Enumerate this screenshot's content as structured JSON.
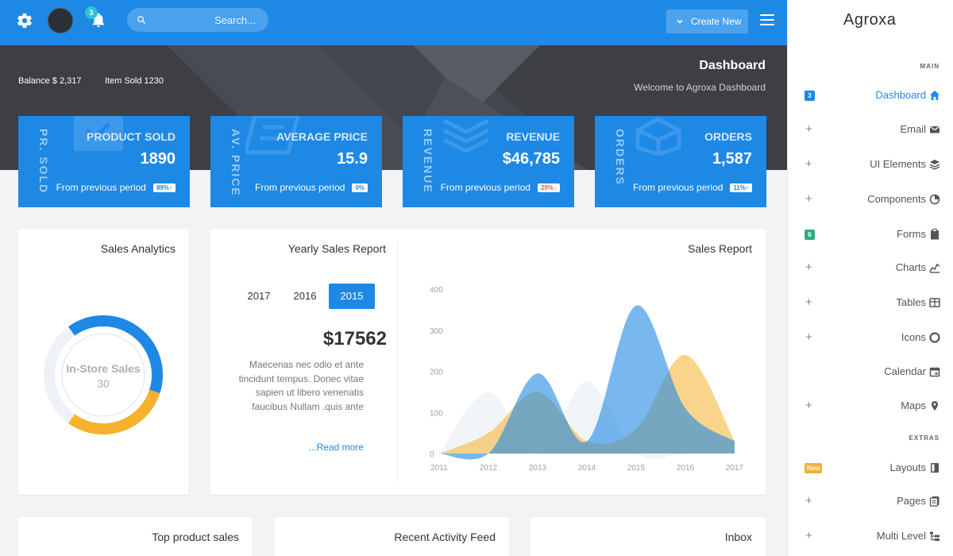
{
  "topbar": {
    "notification_count": "3",
    "search_placeholder": "...Search",
    "create_label": "Create New"
  },
  "header": {
    "balance": "Balance $ 2,317",
    "items_sold": "Item Sold 1230",
    "title": "Dashboard",
    "subtitle": "Welcome to Agroxa Dashboard"
  },
  "stats": [
    {
      "vertical": "PR. SOLD",
      "label": "PRODUCT SOLD",
      "value": "1890",
      "foot": "From previous period",
      "pill": "89%↑",
      "pill_color": "#1e88e5"
    },
    {
      "vertical": "AV. PRICE",
      "label": "AVERAGE PRICE",
      "value": "15.9",
      "foot": "From previous period",
      "pill": "0%",
      "pill_color": "#1e88e5"
    },
    {
      "vertical": "REVENUE",
      "label": "REVENUE",
      "value": "$46,785",
      "foot": "From previous period",
      "pill": "29%↓",
      "pill_color": "#ef5350"
    },
    {
      "vertical": "ORDERS",
      "label": "ORDERS",
      "value": "1,587",
      "foot": "From previous period",
      "pill": "11%↑",
      "pill_color": "#1e88e5"
    }
  ],
  "sales_analytics": {
    "title": "Sales Analytics",
    "center_label": "In-Store Sales",
    "center_value": "30",
    "segments": [
      {
        "value": 40,
        "color": "#1e88e5"
      },
      {
        "value": 30,
        "color": "#f7b12c"
      },
      {
        "value": 30,
        "color": "#eef1f5"
      }
    ]
  },
  "yearly_report": {
    "title": "Yearly Sales Report",
    "years": [
      "2017",
      "2016",
      "2015"
    ],
    "active_year": "2015",
    "amount": "$17562",
    "description": "Maecenas nec odio et ante tincidunt tempus. Donec vitae sapien ut libero venenatis faucibus Nullam .quis ante",
    "read_more": "...Read more"
  },
  "chart_data": {
    "type": "area",
    "title": "Sales Report",
    "x": [
      "2011",
      "2012",
      "2013",
      "2014",
      "2015",
      "2016",
      "2017"
    ],
    "ylim": [
      0,
      400
    ],
    "yticks": [
      "0",
      "100",
      "200",
      "300",
      "400"
    ],
    "series": [
      {
        "values": [
          0,
          150,
          0,
          175,
          0,
          0,
          0
        ],
        "color": "#eef1f5"
      },
      {
        "values": [
          0,
          50,
          150,
          30,
          60,
          240,
          30
        ],
        "color": "#f7b12c"
      },
      {
        "values": [
          0,
          0,
          195,
          30,
          360,
          110,
          30
        ],
        "color": "#1e88e5"
      }
    ]
  },
  "bottom_panels": {
    "top_product": "Top product sales",
    "activity": "Recent Activity Feed",
    "inbox": "Inbox"
  },
  "sidebar": {
    "logo": "Agroxa",
    "main_label": "MAIN",
    "extras_label": "EXTRAS",
    "items": [
      {
        "label": "Dashboard",
        "icon": "home-icon",
        "badge": "3",
        "badge_color": "#1e88e5",
        "active": true
      },
      {
        "label": "Email",
        "icon": "mail-icon"
      },
      {
        "label": "UI Elements",
        "icon": "layers-icon"
      },
      {
        "label": "Components",
        "icon": "pie-icon"
      },
      {
        "label": "Forms",
        "icon": "clipboard-icon",
        "badge": "6",
        "badge_color": "#2fac84"
      },
      {
        "label": "Charts",
        "icon": "chart-icon"
      },
      {
        "label": "Tables",
        "icon": "table-icon"
      },
      {
        "label": "Icons",
        "icon": "circle-icon"
      },
      {
        "label": "Calendar",
        "icon": "calendar-icon"
      },
      {
        "label": "Maps",
        "icon": "pin-icon"
      },
      {
        "label": "Layouts",
        "icon": "layout-icon",
        "badge": "New",
        "badge_color": "#f7b12c"
      },
      {
        "label": "Pages",
        "icon": "pages-icon"
      },
      {
        "label": "Multi Level",
        "icon": "tree-icon"
      }
    ]
  }
}
